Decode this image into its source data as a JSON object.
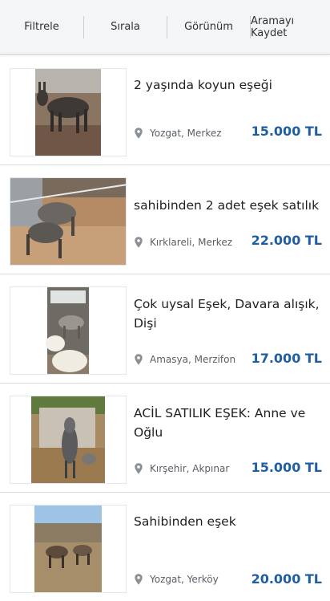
{
  "toolbar": {
    "filter_label": "Filtrele",
    "sort_label": "Sırala",
    "view_label": "Görünüm",
    "save_search_label": "Aramayı Kaydet"
  },
  "listings": [
    {
      "title": "2 yaşında koyun eşeği",
      "location": "Yozgat, Merkez",
      "price": "15.000 TL"
    },
    {
      "title": "sahibinden 2 adet eşek satılık",
      "location": "Kırklareli, Merkez",
      "price": "22.000 TL"
    },
    {
      "title": "Çok uysal Eşek, Davara alışık, Dişi",
      "location": "Amasya, Merzifon",
      "price": "17.000 TL"
    },
    {
      "title": "ACİL SATILIK EŞEK: Anne ve Oğlu",
      "location": "Kırşehir, Akpınar",
      "price": "15.000 TL"
    },
    {
      "title": "Sahibinden eşek",
      "location": "Yozgat, Yerköy",
      "price": "20.000 TL"
    }
  ],
  "colors": {
    "price": "#1f5ea3",
    "toolbar_bg": "#f4f5f7"
  },
  "icons": {
    "location": "map-pin-icon"
  }
}
